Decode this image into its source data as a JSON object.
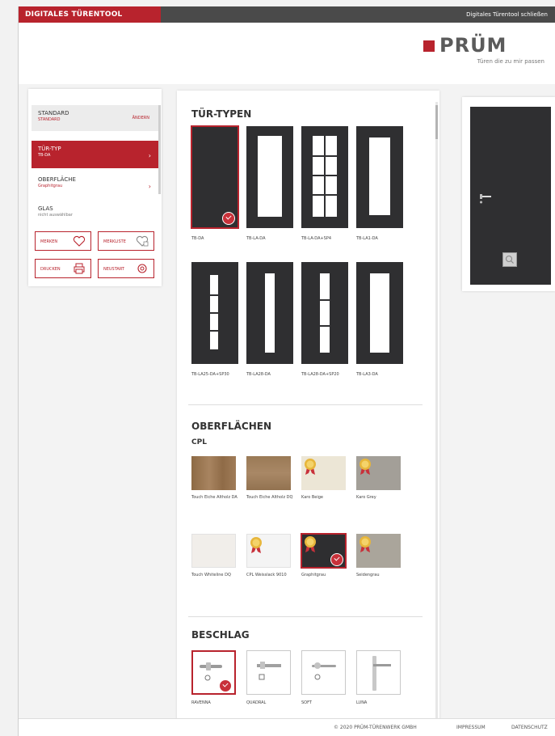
{
  "topbar": {
    "app_title": "DIGITALES TÜRENTOOL",
    "close_label": "Digitales Türentool schließen"
  },
  "logo": {
    "word": "PRÜM",
    "tagline": "Türen die zu mir passen"
  },
  "sidebar": {
    "standard": {
      "label": "STANDARD",
      "sub": "STANDARD",
      "badge": "ÄNDERN"
    },
    "items": [
      {
        "label": "TÜR-TYP",
        "sub": "TB-DA"
      },
      {
        "label": "OBERFLÄCHE",
        "sub": "Graphitgrau"
      },
      {
        "label": "GLAS",
        "sub": "nicht auswählbar"
      }
    ],
    "buttons": {
      "merken": "MERKEN",
      "merkliste": "MERKLISTE",
      "drucken": "DRUCKEN",
      "neustart": "NEUSTART"
    }
  },
  "sections": {
    "tuer_typen": "TÜR-TYPEN",
    "oberflaechen": "OBERFLÄCHEN",
    "cpl": "CPL",
    "beschlag": "BESCHLAG"
  },
  "door_types": [
    {
      "name": "TB-DA",
      "selected": true
    },
    {
      "name": "TB-LA-DA",
      "selected": false
    },
    {
      "name": "TB-LA-DA+SP4",
      "selected": false
    },
    {
      "name": "TB-LA1-DA",
      "selected": false
    },
    {
      "name": "TB-LA25-DA+SP30",
      "selected": false
    },
    {
      "name": "TB-LA28-DA",
      "selected": false
    },
    {
      "name": "TB-LA28-DA+SP20",
      "selected": false
    },
    {
      "name": "TB-LA3-DA",
      "selected": false
    }
  ],
  "surfaces": [
    {
      "name": "Touch Eiche Altholz DA",
      "color": "#9a7650",
      "medal": false,
      "selected": false
    },
    {
      "name": "Touch Eiche Altholz DQ",
      "color": "#9c7c58",
      "medal": false,
      "selected": false
    },
    {
      "name": "Karo Beige",
      "color": "#ece6d6",
      "medal": true,
      "selected": false
    },
    {
      "name": "Karo Grey",
      "color": "#a39f98",
      "medal": true,
      "selected": false
    },
    {
      "name": "Touch Whiteline DQ",
      "color": "#f1eeea",
      "medal": false,
      "selected": false
    },
    {
      "name": "CPL Weisslack 9010",
      "color": "#f4f4f4",
      "medal": true,
      "selected": false
    },
    {
      "name": "Graphitgrau",
      "color": "#2e2e30",
      "medal": true,
      "selected": true
    },
    {
      "name": "Seidengrau",
      "color": "#aaa59b",
      "medal": true,
      "selected": false
    }
  ],
  "fittings": [
    {
      "name": "RAVENNA",
      "selected": true
    },
    {
      "name": "QUADRAL",
      "selected": false
    },
    {
      "name": "SOFT",
      "selected": false
    },
    {
      "name": "LUNA",
      "selected": false
    }
  ],
  "footer": {
    "copyright": "© 2020 PRÜM-TÜRENWERK GMBH",
    "impressum": "IMPRESSUM",
    "datenschutz": "DATENSCHUTZ"
  },
  "colors": {
    "accent": "#b8232d",
    "door": "#2f2f31",
    "topbar": "#4a4a4a"
  }
}
